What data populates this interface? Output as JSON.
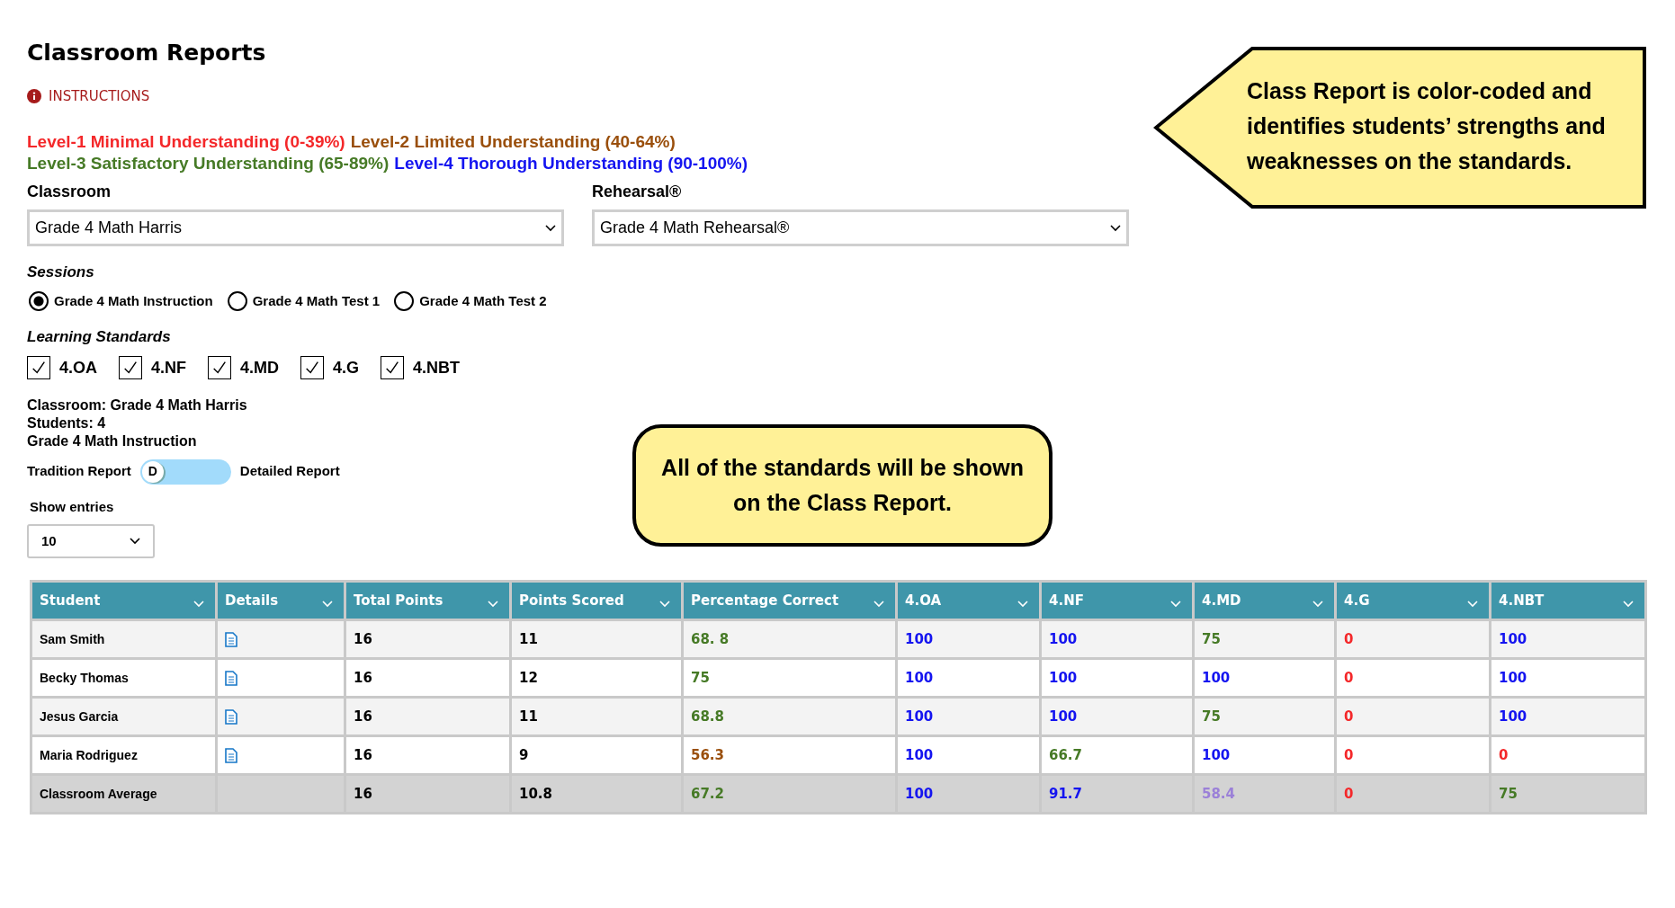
{
  "title": "Classroom Reports",
  "instructions": "INSTRUCTIONS",
  "levels": [
    {
      "text": "Level-1 Minimal Understanding (0-39%)",
      "color": "#f4282a"
    },
    {
      "text": "Level-2 Limited Understanding (40-64%)",
      "color": "#9a4f0c"
    },
    {
      "text": "Level-3 Satisfactory Understanding (65-89%)",
      "color": "#467a26"
    },
    {
      "text": "Level-4 Thorough Understanding (90-100%)",
      "color": "#1414f0"
    }
  ],
  "selects": [
    {
      "label": "Classroom",
      "value": "Grade 4 Math Harris"
    },
    {
      "label": "Rehearsal®",
      "value": "Grade 4 Math Rehearsal®"
    }
  ],
  "sessions": {
    "label": "Sessions",
    "options": [
      {
        "label": "Grade 4 Math Instruction",
        "selected": true
      },
      {
        "label": "Grade 4 Math Test 1",
        "selected": false
      },
      {
        "label": "Grade 4 Math Test 2",
        "selected": false
      }
    ]
  },
  "standards": {
    "label": "Learning Standards",
    "items": [
      {
        "label": "4.OA",
        "checked": true
      },
      {
        "label": "4.NF",
        "checked": true
      },
      {
        "label": "4.MD",
        "checked": true
      },
      {
        "label": "4.G",
        "checked": true
      },
      {
        "label": "4.NBT",
        "checked": true
      }
    ]
  },
  "summary": [
    "Classroom: Grade 4 Math Harris",
    "Students: 4",
    "Grade 4 Math Instruction"
  ],
  "report_toggle": {
    "left_label": "Tradition Report",
    "thumb": "D",
    "on": false,
    "right_label": "Detailed Report"
  },
  "show_entries": {
    "label": "Show entries",
    "value": "10"
  },
  "table": {
    "columns": [
      "Student",
      "Details",
      "Total Points",
      "Points Scored",
      "Percentage Correct",
      "4.OA",
      "4.NF",
      "4.MD",
      "4.G",
      "4.NBT"
    ],
    "rows": [
      {
        "kind": "student",
        "student": "Sam Smith",
        "total": "16",
        "scored": "11",
        "scores": [
          {
            "text": "68. 8",
            "color": "#467a26"
          },
          {
            "text": "100",
            "color": "#1414f0"
          },
          {
            "text": "100",
            "color": "#1414f0"
          },
          {
            "text": "75",
            "color": "#467a26"
          },
          {
            "text": "0",
            "color": "#f4282a"
          },
          {
            "text": "100",
            "color": "#1414f0"
          }
        ]
      },
      {
        "kind": "student",
        "student": "Becky Thomas",
        "total": "16",
        "scored": "12",
        "scores": [
          {
            "text": "75",
            "color": "#467a26"
          },
          {
            "text": "100",
            "color": "#1414f0"
          },
          {
            "text": "100",
            "color": "#1414f0"
          },
          {
            "text": "100",
            "color": "#1414f0"
          },
          {
            "text": "0",
            "color": "#f4282a"
          },
          {
            "text": "100",
            "color": "#1414f0"
          }
        ]
      },
      {
        "kind": "student",
        "student": "Jesus Garcia",
        "total": "16",
        "scored": "11",
        "scores": [
          {
            "text": "68.8",
            "color": "#467a26"
          },
          {
            "text": "100",
            "color": "#1414f0"
          },
          {
            "text": "100",
            "color": "#1414f0"
          },
          {
            "text": "75",
            "color": "#467a26"
          },
          {
            "text": "0",
            "color": "#f4282a"
          },
          {
            "text": "100",
            "color": "#1414f0"
          }
        ]
      },
      {
        "kind": "student",
        "student": "Maria Rodriguez",
        "total": "16",
        "scored": "9",
        "scores": [
          {
            "text": "56.3",
            "color": "#9a4f0c"
          },
          {
            "text": "100",
            "color": "#1414f0"
          },
          {
            "text": "66.7",
            "color": "#467a26"
          },
          {
            "text": "100",
            "color": "#1414f0"
          },
          {
            "text": "0",
            "color": "#f4282a"
          },
          {
            "text": "0",
            "color": "#f4282a"
          }
        ]
      },
      {
        "kind": "average",
        "student": "Classroom Average",
        "total": "16",
        "scored": "10.8",
        "scores": [
          {
            "text": "67.2",
            "color": "#467a26"
          },
          {
            "text": "100",
            "color": "#1414f0"
          },
          {
            "text": "91.7",
            "color": "#1414f0"
          },
          {
            "text": "58.4",
            "color": "#9b80d8"
          },
          {
            "text": "0",
            "color": "#f4282a"
          },
          {
            "text": "75",
            "color": "#467a26"
          }
        ]
      }
    ]
  },
  "callouts": [
    {
      "kind": "arrow",
      "text": "Class Report is color-coded and identifies students’ strengths and weaknesses on the standards."
    },
    {
      "kind": "rounded",
      "text": "All of the standards will be shown on the Class Report."
    }
  ]
}
